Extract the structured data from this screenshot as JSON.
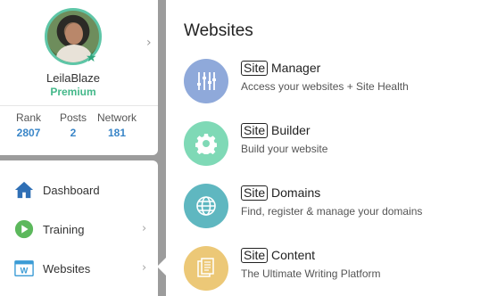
{
  "profile": {
    "username": "LeilaBlaze",
    "membership": "Premium",
    "stats": [
      {
        "label": "Rank",
        "value": "2807"
      },
      {
        "label": "Posts",
        "value": "2"
      },
      {
        "label": "Network",
        "value": "181"
      }
    ]
  },
  "nav": {
    "items": [
      {
        "label": "Dashboard",
        "icon": "house-icon"
      },
      {
        "label": "Training",
        "icon": "play-icon"
      },
      {
        "label": "Websites",
        "icon": "websites-icon",
        "icon_text": "W"
      }
    ]
  },
  "panel": {
    "title": "Websites",
    "items": [
      {
        "badge": "Site",
        "title": "Manager",
        "desc": "Access your websites + Site Health",
        "color": "#8fa9da",
        "icon": "sliders-icon"
      },
      {
        "badge": "Site",
        "title": "Builder",
        "desc": "Build your website",
        "color": "#7fd9b6",
        "icon": "gear-icon"
      },
      {
        "badge": "Site",
        "title": "Domains",
        "desc": "Find, register & manage your domains",
        "color": "#5fb7c0",
        "icon": "globe-icon"
      },
      {
        "badge": "Site",
        "title": "Content",
        "desc": "The Ultimate Writing Platform",
        "color": "#ecc877",
        "icon": "documents-icon"
      }
    ]
  },
  "colors": {
    "accent_blue": "#3a86c8",
    "premium_green": "#44b88a",
    "backdrop": "#9c9c9c"
  }
}
